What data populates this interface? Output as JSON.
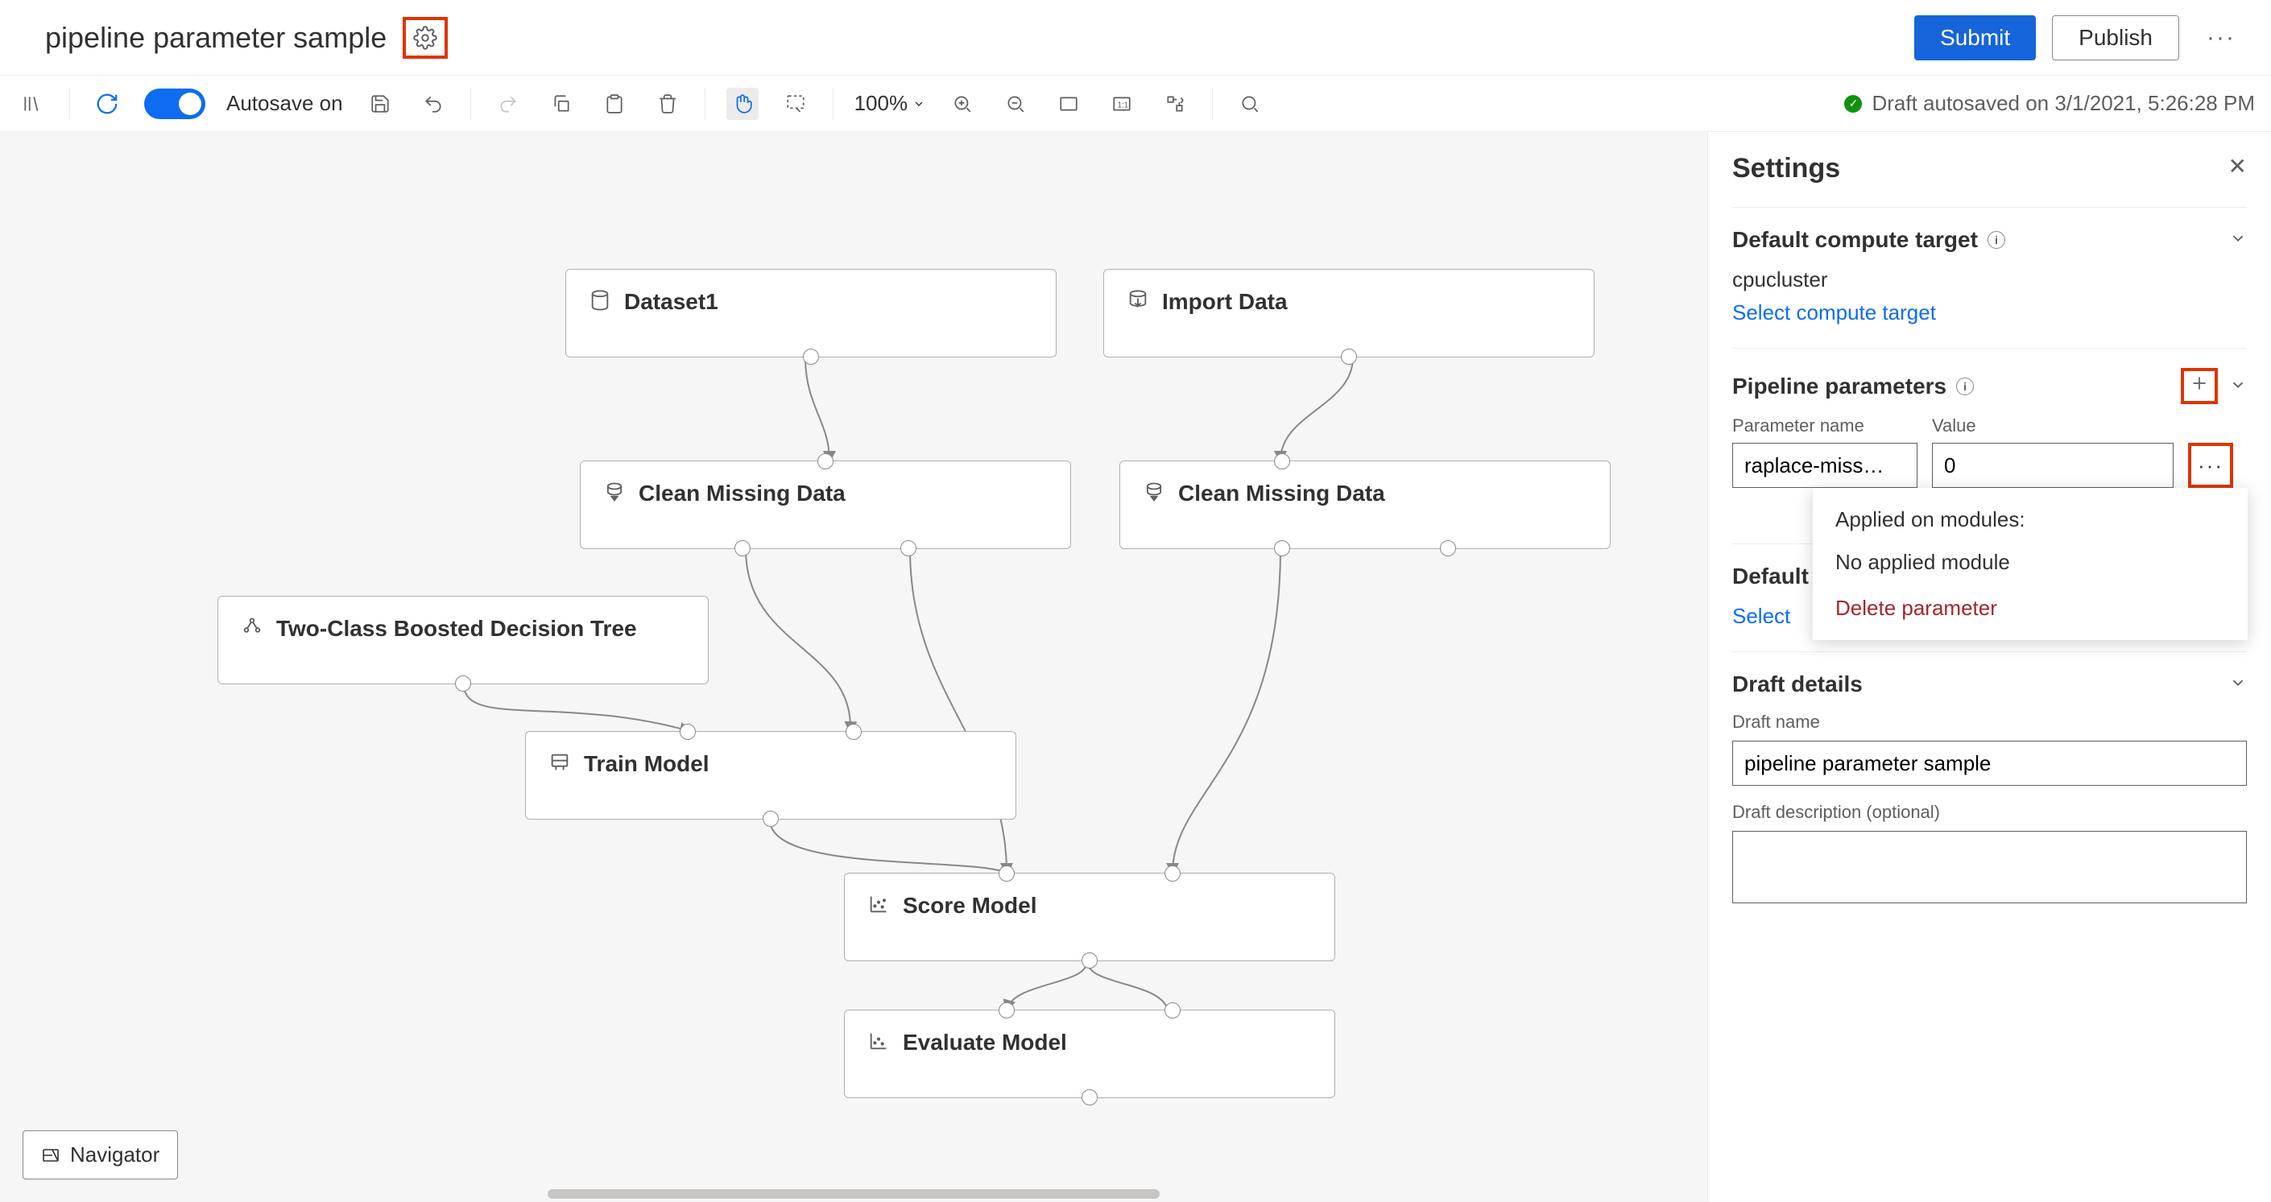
{
  "header": {
    "title": "pipeline parameter sample",
    "submit": "Submit",
    "publish": "Publish"
  },
  "toolbar": {
    "autosave_label": "Autosave on",
    "zoom": "100%",
    "status": "Draft autosaved on 3/1/2021, 5:26:28 PM"
  },
  "nodes": {
    "dataset1": "Dataset1",
    "import_data": "Import Data",
    "clean1": "Clean Missing Data",
    "clean2": "Clean Missing Data",
    "bdt": "Two-Class Boosted Decision Tree",
    "train": "Train Model",
    "score": "Score Model",
    "evaluate": "Evaluate Model"
  },
  "navigator": "Navigator",
  "panel": {
    "title": "Settings",
    "compute_head": "Default compute target",
    "compute_value": "cpucluster",
    "compute_link": "Select compute target",
    "params_head": "Pipeline parameters",
    "param_name_lbl": "Parameter name",
    "param_value_lbl": "Value",
    "param_name": "raplace-miss…",
    "param_value": "0",
    "popover_applied": "Applied on modules:",
    "popover_none": "No applied module",
    "popover_delete": "Delete parameter",
    "default2_head": "Default",
    "default2_link_prefix": "Select ",
    "draft_head": "Draft details",
    "draft_name_lbl": "Draft name",
    "draft_name": "pipeline parameter sample",
    "draft_desc_lbl": "Draft description (optional)"
  }
}
